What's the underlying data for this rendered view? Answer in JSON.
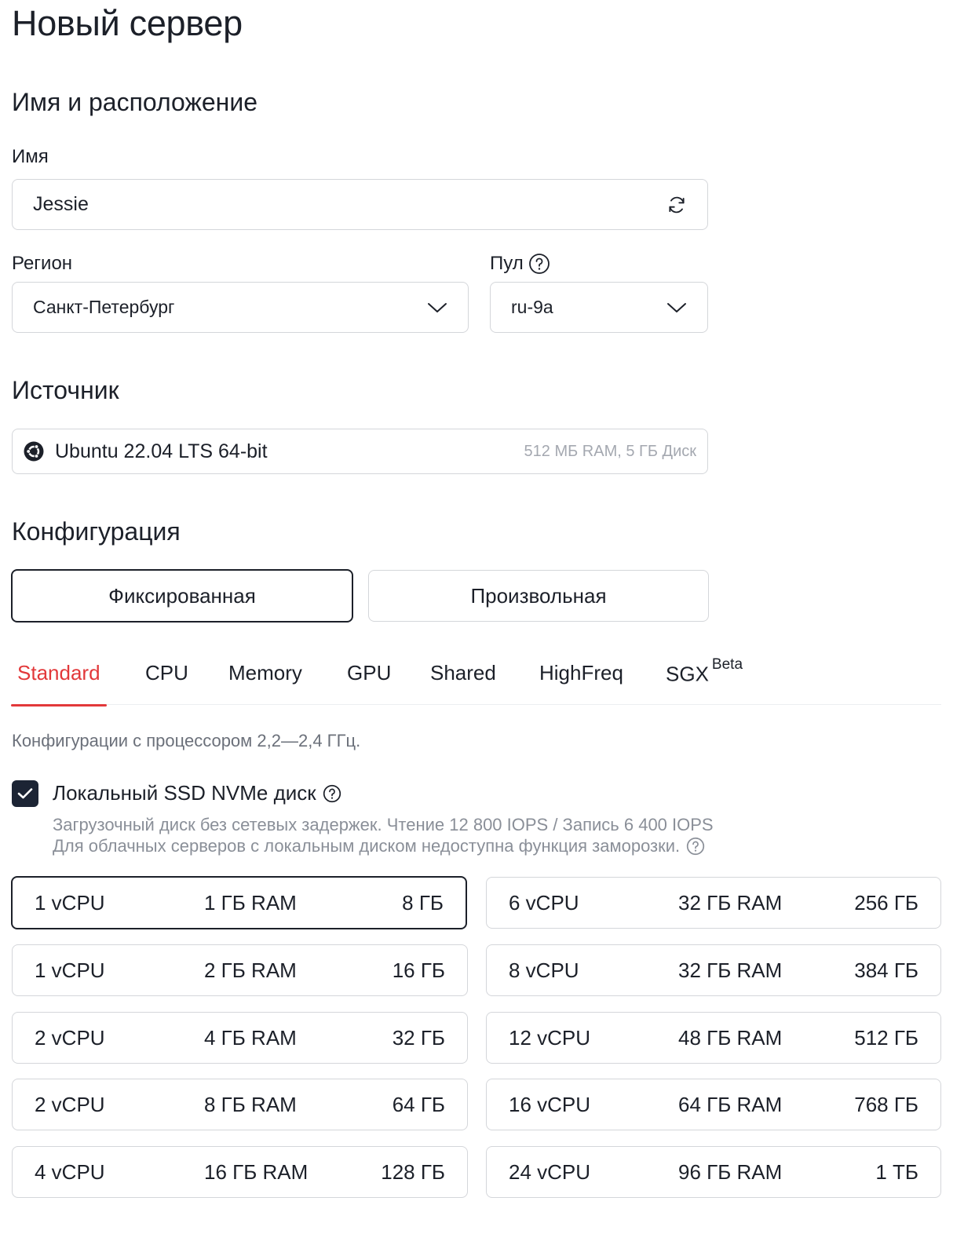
{
  "page": {
    "title": "Новый сервер"
  },
  "name_location": {
    "section_title": "Имя и расположение",
    "name_label": "Имя",
    "name_value": "Jessie",
    "region_label": "Регион",
    "region_value": "Санкт-Петербург",
    "pool_label": "Пул",
    "pool_value": "ru-9a"
  },
  "source": {
    "section_title": "Источник",
    "os_name": "Ubuntu 22.04 LTS 64-bit",
    "requirements": "512 МБ RAM, 5 ГБ Диск"
  },
  "configuration": {
    "section_title": "Конфигурация",
    "modes": [
      {
        "label": "Фиксированная",
        "active": true
      },
      {
        "label": "Произвольная",
        "active": false
      }
    ],
    "tabs": [
      {
        "label": "Standard",
        "active": true
      },
      {
        "label": "CPU"
      },
      {
        "label": "Memory"
      },
      {
        "label": "GPU"
      },
      {
        "label": "Shared"
      },
      {
        "label": "HighFreq"
      },
      {
        "label": "SGX",
        "badge": "Beta"
      }
    ],
    "description": "Конфигурации с процессором 2,2—2,4 ГГц.",
    "local_disk": {
      "label": "Локальный SSD NVMe диск",
      "checked": true,
      "note_line1": "Загрузочный диск без сетевых задержек. Чтение 12 800 IOPS / Запись 6 400 IOPS",
      "note_line2": "Для облачных серверов с локальным диском недоступна функция заморозки."
    },
    "plans_left": [
      {
        "cpu": "1 vCPU",
        "ram": "1 ГБ RAM",
        "disk": "8 ГБ",
        "selected": true
      },
      {
        "cpu": "1 vCPU",
        "ram": "2 ГБ RAM",
        "disk": "16 ГБ"
      },
      {
        "cpu": "2 vCPU",
        "ram": "4 ГБ RAM",
        "disk": "32 ГБ"
      },
      {
        "cpu": "2 vCPU",
        "ram": "8 ГБ RAM",
        "disk": "64 ГБ"
      },
      {
        "cpu": "4 vCPU",
        "ram": "16 ГБ RAM",
        "disk": "128 ГБ"
      }
    ],
    "plans_right": [
      {
        "cpu": "6 vCPU",
        "ram": "32 ГБ RAM",
        "disk": "256 ГБ"
      },
      {
        "cpu": "8 vCPU",
        "ram": "32 ГБ RAM",
        "disk": "384 ГБ"
      },
      {
        "cpu": "12 vCPU",
        "ram": "48 ГБ RAM",
        "disk": "512 ГБ"
      },
      {
        "cpu": "16 vCPU",
        "ram": "64 ГБ RAM",
        "disk": "768 ГБ"
      },
      {
        "cpu": "24 vCPU",
        "ram": "96 ГБ RAM",
        "disk": "1 ТБ"
      }
    ]
  },
  "colors": {
    "accent": "#e2383a",
    "text": "#1c2029",
    "border": "#d4d6da",
    "muted": "#8a8f98"
  },
  "icons": [
    "refresh-icon",
    "chevron-down-icon",
    "help-icon",
    "ubuntu-icon",
    "checkmark-icon"
  ]
}
